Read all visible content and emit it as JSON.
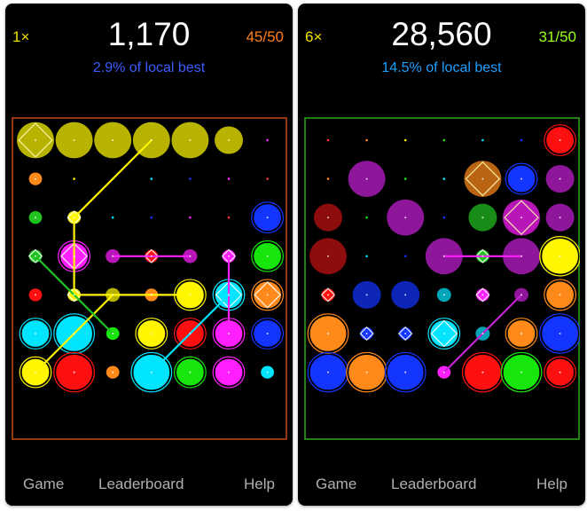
{
  "screens": [
    {
      "multiplier": "1×",
      "score": "1,170",
      "moves": "45/50",
      "best": "2.9% of local best",
      "colors": {
        "multiplier": "#f2e000",
        "moves": "#ff7f1a",
        "best": "#3a5cff",
        "border": "#c24a18"
      },
      "pieces": [
        {
          "r": 0,
          "c": 0,
          "color": "#fff600",
          "size": "L",
          "shape": "diamond",
          "dim": true
        },
        {
          "r": 0,
          "c": 1,
          "color": "#fff600",
          "size": "L",
          "dim": true
        },
        {
          "r": 0,
          "c": 2,
          "color": "#fff600",
          "size": "L",
          "dim": true
        },
        {
          "r": 0,
          "c": 3,
          "color": "#fff600",
          "size": "L",
          "dim": true
        },
        {
          "r": 0,
          "c": 4,
          "color": "#fff600",
          "size": "L",
          "dim": true
        },
        {
          "r": 0,
          "c": 5,
          "color": "#fff600",
          "size": "M",
          "dim": true
        },
        {
          "r": 1,
          "c": 0,
          "color": "#ff8a1a",
          "size": "S"
        },
        {
          "r": 2,
          "c": 0,
          "color": "#21c21f",
          "size": "S"
        },
        {
          "r": 2,
          "c": 1,
          "color": "#fff600",
          "size": "S",
          "shape": "diamond"
        },
        {
          "r": 2,
          "c": 6,
          "color": "#1434ff",
          "size": "M"
        },
        {
          "r": 3,
          "c": 0,
          "color": "#21c21f",
          "size": "S",
          "shape": "diamond"
        },
        {
          "r": 3,
          "c": 1,
          "color": "#ff1fff",
          "size": "M",
          "shape": "diamond"
        },
        {
          "r": 3,
          "c": 2,
          "color": "#ff1fff",
          "size": "S",
          "dim": true
        },
        {
          "r": 3,
          "c": 3,
          "color": "#ff1010",
          "size": "S",
          "shape": "diamond"
        },
        {
          "r": 3,
          "c": 4,
          "color": "#ff1fff",
          "size": "S",
          "dim": true
        },
        {
          "r": 3,
          "c": 5,
          "color": "#ff1fff",
          "size": "S",
          "shape": "diamond"
        },
        {
          "r": 3,
          "c": 6,
          "color": "#16e60c",
          "size": "M"
        },
        {
          "r": 4,
          "c": 0,
          "color": "#ff1010",
          "size": "S"
        },
        {
          "r": 4,
          "c": 1,
          "color": "#fff600",
          "size": "S",
          "shape": "diamond"
        },
        {
          "r": 4,
          "c": 2,
          "color": "#fff600",
          "size": "S",
          "dim": true
        },
        {
          "r": 4,
          "c": 3,
          "color": "#ff8a1a",
          "size": "S"
        },
        {
          "r": 4,
          "c": 4,
          "color": "#fff600",
          "size": "M"
        },
        {
          "r": 4,
          "c": 5,
          "color": "#00e5ff",
          "size": "M",
          "shape": "diamond"
        },
        {
          "r": 4,
          "c": 6,
          "color": "#ff8a1a",
          "size": "M",
          "shape": "diamond"
        },
        {
          "r": 5,
          "c": 0,
          "color": "#00e5ff",
          "size": "M"
        },
        {
          "r": 5,
          "c": 1,
          "color": "#00e5ff",
          "size": "L"
        },
        {
          "r": 5,
          "c": 2,
          "color": "#16e60c",
          "size": "S"
        },
        {
          "r": 5,
          "c": 3,
          "color": "#fff600",
          "size": "M"
        },
        {
          "r": 5,
          "c": 4,
          "color": "#ff1010",
          "size": "M"
        },
        {
          "r": 5,
          "c": 5,
          "color": "#ff1fff",
          "size": "M"
        },
        {
          "r": 5,
          "c": 6,
          "color": "#1434ff",
          "size": "M"
        },
        {
          "r": 6,
          "c": 0,
          "color": "#fff600",
          "size": "M"
        },
        {
          "r": 6,
          "c": 1,
          "color": "#ff1010",
          "size": "L"
        },
        {
          "r": 6,
          "c": 2,
          "color": "#ff8a1a",
          "size": "S"
        },
        {
          "r": 6,
          "c": 3,
          "color": "#00e5ff",
          "size": "L"
        },
        {
          "r": 6,
          "c": 4,
          "color": "#16e60c",
          "size": "M"
        },
        {
          "r": 6,
          "c": 5,
          "color": "#ff1fff",
          "size": "M"
        },
        {
          "r": 6,
          "c": 6,
          "color": "#00e5ff",
          "size": "S"
        }
      ],
      "links": [
        {
          "from": [
            2,
            1
          ],
          "to": [
            4,
            1
          ],
          "color": "#fff600"
        },
        {
          "from": [
            2,
            1
          ],
          "to": [
            0,
            3
          ],
          "color": "#fff600"
        },
        {
          "from": [
            4,
            1
          ],
          "to": [
            4,
            4
          ],
          "color": "#fff600"
        },
        {
          "from": [
            4,
            2
          ],
          "to": [
            6,
            0
          ],
          "color": "#fff600"
        },
        {
          "from": [
            3,
            0
          ],
          "to": [
            5,
            2
          ],
          "color": "#21c21f"
        },
        {
          "from": [
            3,
            2
          ],
          "to": [
            3,
            4
          ],
          "color": "#ff1fff"
        },
        {
          "from": [
            3,
            5
          ],
          "to": [
            5,
            5
          ],
          "color": "#ff1fff"
        },
        {
          "from": [
            4,
            5
          ],
          "to": [
            6,
            3
          ],
          "color": "#00e5ff"
        }
      ]
    },
    {
      "multiplier": "6×",
      "score": "28,560",
      "moves": "31/50",
      "best": "14.5% of local best",
      "colors": {
        "multiplier": "#f2e000",
        "moves": "#9aff1a",
        "best": "#1ea0ff",
        "border": "#2fa81a"
      },
      "pieces": [
        {
          "r": 0,
          "c": 6,
          "color": "#ff1010",
          "size": "M"
        },
        {
          "r": 1,
          "c": 1,
          "color": "#c51fd6",
          "size": "L",
          "dim": true
        },
        {
          "r": 1,
          "c": 4,
          "color": "#ff8a1a",
          "size": "L",
          "shape": "diamond",
          "dim": true
        },
        {
          "r": 1,
          "c": 5,
          "color": "#1434ff",
          "size": "M"
        },
        {
          "r": 1,
          "c": 6,
          "color": "#c51fd6",
          "size": "M",
          "dim": true
        },
        {
          "r": 2,
          "c": 0,
          "color": "#c41010",
          "size": "M",
          "dim": true
        },
        {
          "r": 2,
          "c": 2,
          "color": "#c51fd6",
          "size": "L",
          "dim": true
        },
        {
          "r": 2,
          "c": 4,
          "color": "#21c21f",
          "size": "M",
          "dim": true
        },
        {
          "r": 2,
          "c": 5,
          "color": "#ff1fff",
          "size": "L",
          "shape": "diamond",
          "dim": true
        },
        {
          "r": 2,
          "c": 6,
          "color": "#c51fd6",
          "size": "M",
          "dim": true
        },
        {
          "r": 3,
          "c": 0,
          "color": "#c41010",
          "size": "L",
          "dim": true
        },
        {
          "r": 3,
          "c": 3,
          "color": "#c51fd6",
          "size": "L",
          "dim": true
        },
        {
          "r": 3,
          "c": 4,
          "color": "#21c21f",
          "size": "S",
          "shape": "diamond"
        },
        {
          "r": 3,
          "c": 5,
          "color": "#c51fd6",
          "size": "L",
          "dim": true
        },
        {
          "r": 3,
          "c": 6,
          "color": "#fff600",
          "size": "L"
        },
        {
          "r": 4,
          "c": 0,
          "color": "#ff1010",
          "size": "S",
          "shape": "diamond"
        },
        {
          "r": 4,
          "c": 1,
          "color": "#1434ff",
          "size": "M",
          "dim": true
        },
        {
          "r": 4,
          "c": 2,
          "color": "#1434ff",
          "size": "M",
          "dim": true
        },
        {
          "r": 4,
          "c": 3,
          "color": "#00e5ff",
          "size": "S",
          "dim": true
        },
        {
          "r": 4,
          "c": 4,
          "color": "#ff1fff",
          "size": "S",
          "shape": "diamond"
        },
        {
          "r": 4,
          "c": 5,
          "color": "#c51fd6",
          "size": "S",
          "dim": true
        },
        {
          "r": 4,
          "c": 6,
          "color": "#ff8a1a",
          "size": "M"
        },
        {
          "r": 5,
          "c": 0,
          "color": "#ff8a1a",
          "size": "L"
        },
        {
          "r": 5,
          "c": 1,
          "color": "#1434ff",
          "size": "S",
          "shape": "diamond"
        },
        {
          "r": 5,
          "c": 2,
          "color": "#1434ff",
          "size": "S",
          "shape": "diamond"
        },
        {
          "r": 5,
          "c": 3,
          "color": "#00e5ff",
          "size": "M",
          "shape": "diamond"
        },
        {
          "r": 5,
          "c": 4,
          "color": "#00e5ff",
          "size": "S",
          "dim": true
        },
        {
          "r": 5,
          "c": 5,
          "color": "#ff8a1a",
          "size": "M"
        },
        {
          "r": 5,
          "c": 6,
          "color": "#1434ff",
          "size": "L"
        },
        {
          "r": 6,
          "c": 0,
          "color": "#1434ff",
          "size": "L"
        },
        {
          "r": 6,
          "c": 1,
          "color": "#ff8a1a",
          "size": "L"
        },
        {
          "r": 6,
          "c": 2,
          "color": "#1434ff",
          "size": "L"
        },
        {
          "r": 6,
          "c": 3,
          "color": "#ff1fff",
          "size": "S"
        },
        {
          "r": 6,
          "c": 4,
          "color": "#ff1010",
          "size": "L"
        },
        {
          "r": 6,
          "c": 5,
          "color": "#16e60c",
          "size": "L"
        },
        {
          "r": 6,
          "c": 6,
          "color": "#ff1010",
          "size": "M"
        }
      ],
      "links": [
        {
          "from": [
            3,
            3
          ],
          "to": [
            3,
            5
          ],
          "color": "#ff1fff"
        },
        {
          "from": [
            4,
            5
          ],
          "to": [
            6,
            3
          ],
          "color": "#c51fd6"
        }
      ]
    }
  ],
  "nav": {
    "game": "Game",
    "leaderboard": "Leaderboard",
    "help": "Help"
  }
}
